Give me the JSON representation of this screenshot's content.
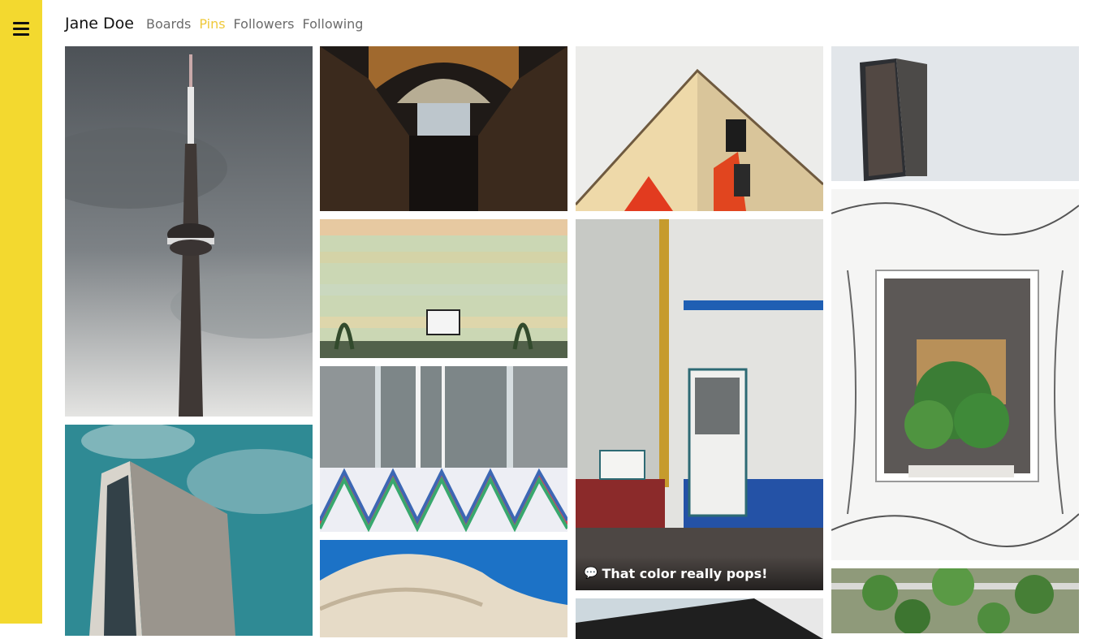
{
  "sidebar": {
    "menu_icon": "hamburger-menu-icon",
    "color": "#f3d92f"
  },
  "header": {
    "profile_name": "Jane Doe",
    "tabs": [
      {
        "label": "Boards",
        "active": false
      },
      {
        "label": "Pins",
        "active": true
      },
      {
        "label": "Followers",
        "active": false
      },
      {
        "label": "Following",
        "active": false
      }
    ]
  },
  "accent_color": "#efc93a",
  "pins": [
    {
      "subject": "cn-tower"
    },
    {
      "subject": "library-hall"
    },
    {
      "subject": "striped-building-corner"
    },
    {
      "subject": "glass-tower"
    },
    {
      "subject": "apartment-block-basketball"
    },
    {
      "subject": "white-door-wall",
      "caption": "That color really pops!",
      "caption_icon": "comment-icon"
    },
    {
      "subject": "window-with-plants-mural"
    },
    {
      "subject": "frosted-windows"
    },
    {
      "subject": "colorful-zigzag-lines"
    },
    {
      "subject": "blue-sky-tower"
    },
    {
      "subject": "curved-white-building"
    },
    {
      "subject": "overhang-roof"
    },
    {
      "subject": "green-balconies"
    }
  ]
}
